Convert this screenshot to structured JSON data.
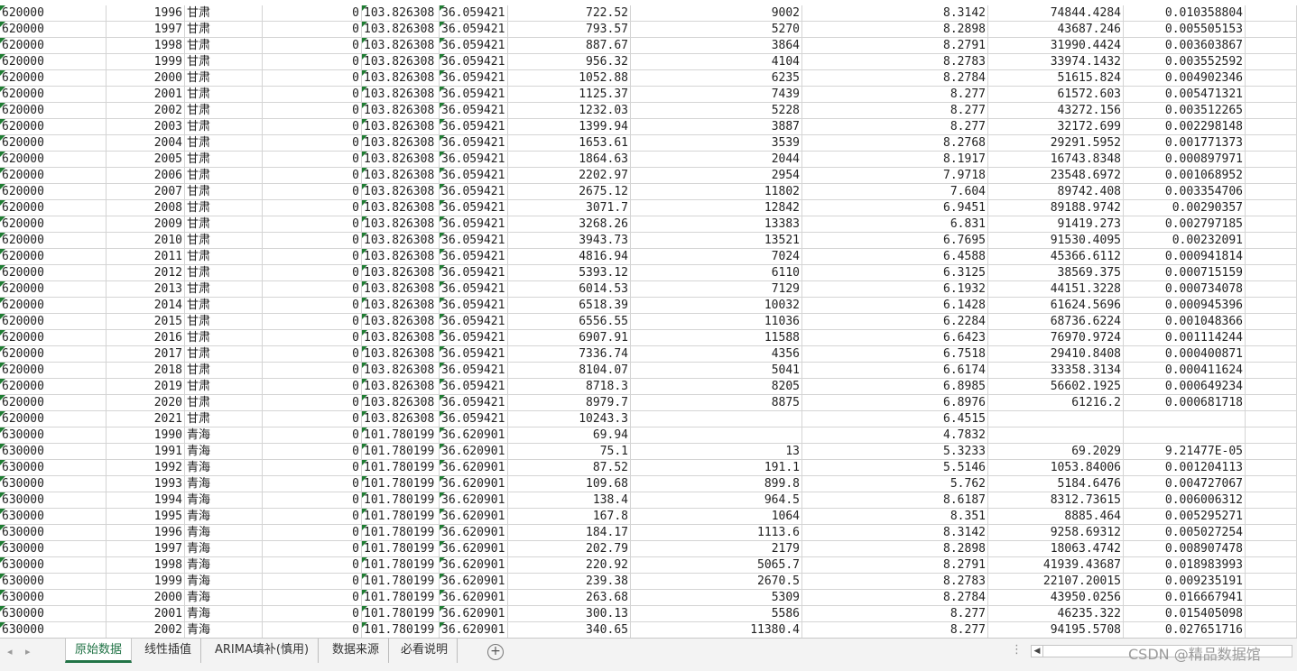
{
  "sheet_tabs": [
    {
      "label": "原始数据",
      "active": true
    },
    {
      "label": "线性插值",
      "active": false
    },
    {
      "label": "ARIMA填补(慎用)",
      "active": false
    },
    {
      "label": "数据来源",
      "active": false
    },
    {
      "label": "必看说明",
      "active": false
    }
  ],
  "add_sheet_symbol": "+",
  "watermark": "CSDN @精品数据馆",
  "colors": {
    "active_tab": "#217346",
    "grid_line": "#d4d4d4",
    "error_triangle": "#1e7d32"
  },
  "rows": [
    [
      "620000",
      "1996",
      "甘肃",
      "0",
      "103.826308",
      "36.059421",
      "722.52",
      "9002",
      "8.3142",
      "74844.4284",
      "0.010358804"
    ],
    [
      "620000",
      "1997",
      "甘肃",
      "0",
      "103.826308",
      "36.059421",
      "793.57",
      "5270",
      "8.2898",
      "43687.246",
      "0.005505153"
    ],
    [
      "620000",
      "1998",
      "甘肃",
      "0",
      "103.826308",
      "36.059421",
      "887.67",
      "3864",
      "8.2791",
      "31990.4424",
      "0.003603867"
    ],
    [
      "620000",
      "1999",
      "甘肃",
      "0",
      "103.826308",
      "36.059421",
      "956.32",
      "4104",
      "8.2783",
      "33974.1432",
      "0.003552592"
    ],
    [
      "620000",
      "2000",
      "甘肃",
      "0",
      "103.826308",
      "36.059421",
      "1052.88",
      "6235",
      "8.2784",
      "51615.824",
      "0.004902346"
    ],
    [
      "620000",
      "2001",
      "甘肃",
      "0",
      "103.826308",
      "36.059421",
      "1125.37",
      "7439",
      "8.277",
      "61572.603",
      "0.005471321"
    ],
    [
      "620000",
      "2002",
      "甘肃",
      "0",
      "103.826308",
      "36.059421",
      "1232.03",
      "5228",
      "8.277",
      "43272.156",
      "0.003512265"
    ],
    [
      "620000",
      "2003",
      "甘肃",
      "0",
      "103.826308",
      "36.059421",
      "1399.94",
      "3887",
      "8.277",
      "32172.699",
      "0.002298148"
    ],
    [
      "620000",
      "2004",
      "甘肃",
      "0",
      "103.826308",
      "36.059421",
      "1653.61",
      "3539",
      "8.2768",
      "29291.5952",
      "0.001771373"
    ],
    [
      "620000",
      "2005",
      "甘肃",
      "0",
      "103.826308",
      "36.059421",
      "1864.63",
      "2044",
      "8.1917",
      "16743.8348",
      "0.000897971"
    ],
    [
      "620000",
      "2006",
      "甘肃",
      "0",
      "103.826308",
      "36.059421",
      "2202.97",
      "2954",
      "7.9718",
      "23548.6972",
      "0.001068952"
    ],
    [
      "620000",
      "2007",
      "甘肃",
      "0",
      "103.826308",
      "36.059421",
      "2675.12",
      "11802",
      "7.604",
      "89742.408",
      "0.003354706"
    ],
    [
      "620000",
      "2008",
      "甘肃",
      "0",
      "103.826308",
      "36.059421",
      "3071.7",
      "12842",
      "6.9451",
      "89188.9742",
      "0.00290357"
    ],
    [
      "620000",
      "2009",
      "甘肃",
      "0",
      "103.826308",
      "36.059421",
      "3268.26",
      "13383",
      "6.831",
      "91419.273",
      "0.002797185"
    ],
    [
      "620000",
      "2010",
      "甘肃",
      "0",
      "103.826308",
      "36.059421",
      "3943.73",
      "13521",
      "6.7695",
      "91530.4095",
      "0.00232091"
    ],
    [
      "620000",
      "2011",
      "甘肃",
      "0",
      "103.826308",
      "36.059421",
      "4816.94",
      "7024",
      "6.4588",
      "45366.6112",
      "0.000941814"
    ],
    [
      "620000",
      "2012",
      "甘肃",
      "0",
      "103.826308",
      "36.059421",
      "5393.12",
      "6110",
      "6.3125",
      "38569.375",
      "0.000715159"
    ],
    [
      "620000",
      "2013",
      "甘肃",
      "0",
      "103.826308",
      "36.059421",
      "6014.53",
      "7129",
      "6.1932",
      "44151.3228",
      "0.000734078"
    ],
    [
      "620000",
      "2014",
      "甘肃",
      "0",
      "103.826308",
      "36.059421",
      "6518.39",
      "10032",
      "6.1428",
      "61624.5696",
      "0.000945396"
    ],
    [
      "620000",
      "2015",
      "甘肃",
      "0",
      "103.826308",
      "36.059421",
      "6556.55",
      "11036",
      "6.2284",
      "68736.6224",
      "0.001048366"
    ],
    [
      "620000",
      "2016",
      "甘肃",
      "0",
      "103.826308",
      "36.059421",
      "6907.91",
      "11588",
      "6.6423",
      "76970.9724",
      "0.001114244"
    ],
    [
      "620000",
      "2017",
      "甘肃",
      "0",
      "103.826308",
      "36.059421",
      "7336.74",
      "4356",
      "6.7518",
      "29410.8408",
      "0.000400871"
    ],
    [
      "620000",
      "2018",
      "甘肃",
      "0",
      "103.826308",
      "36.059421",
      "8104.07",
      "5041",
      "6.6174",
      "33358.3134",
      "0.000411624"
    ],
    [
      "620000",
      "2019",
      "甘肃",
      "0",
      "103.826308",
      "36.059421",
      "8718.3",
      "8205",
      "6.8985",
      "56602.1925",
      "0.000649234"
    ],
    [
      "620000",
      "2020",
      "甘肃",
      "0",
      "103.826308",
      "36.059421",
      "8979.7",
      "8875",
      "6.8976",
      "61216.2",
      "0.000681718"
    ],
    [
      "620000",
      "2021",
      "甘肃",
      "0",
      "103.826308",
      "36.059421",
      "10243.3",
      "",
      "6.4515",
      "",
      ""
    ],
    [
      "630000",
      "1990",
      "青海",
      "0",
      "101.780199",
      "36.620901",
      "69.94",
      "",
      "4.7832",
      "",
      ""
    ],
    [
      "630000",
      "1991",
      "青海",
      "0",
      "101.780199",
      "36.620901",
      "75.1",
      "13",
      "5.3233",
      "69.2029",
      "9.21477E-05"
    ],
    [
      "630000",
      "1992",
      "青海",
      "0",
      "101.780199",
      "36.620901",
      "87.52",
      "191.1",
      "5.5146",
      "1053.84006",
      "0.001204113"
    ],
    [
      "630000",
      "1993",
      "青海",
      "0",
      "101.780199",
      "36.620901",
      "109.68",
      "899.8",
      "5.762",
      "5184.6476",
      "0.004727067"
    ],
    [
      "630000",
      "1994",
      "青海",
      "0",
      "101.780199",
      "36.620901",
      "138.4",
      "964.5",
      "8.6187",
      "8312.73615",
      "0.006006312"
    ],
    [
      "630000",
      "1995",
      "青海",
      "0",
      "101.780199",
      "36.620901",
      "167.8",
      "1064",
      "8.351",
      "8885.464",
      "0.005295271"
    ],
    [
      "630000",
      "1996",
      "青海",
      "0",
      "101.780199",
      "36.620901",
      "184.17",
      "1113.6",
      "8.3142",
      "9258.69312",
      "0.005027254"
    ],
    [
      "630000",
      "1997",
      "青海",
      "0",
      "101.780199",
      "36.620901",
      "202.79",
      "2179",
      "8.2898",
      "18063.4742",
      "0.008907478"
    ],
    [
      "630000",
      "1998",
      "青海",
      "0",
      "101.780199",
      "36.620901",
      "220.92",
      "5065.7",
      "8.2791",
      "41939.43687",
      "0.018983993"
    ],
    [
      "630000",
      "1999",
      "青海",
      "0",
      "101.780199",
      "36.620901",
      "239.38",
      "2670.5",
      "8.2783",
      "22107.20015",
      "0.009235191"
    ],
    [
      "630000",
      "2000",
      "青海",
      "0",
      "101.780199",
      "36.620901",
      "263.68",
      "5309",
      "8.2784",
      "43950.0256",
      "0.016667941"
    ],
    [
      "630000",
      "2001",
      "青海",
      "0",
      "101.780199",
      "36.620901",
      "300.13",
      "5586",
      "8.277",
      "46235.322",
      "0.015405098"
    ],
    [
      "630000",
      "2002",
      "青海",
      "0",
      "101.780199",
      "36.620901",
      "340.65",
      "11380.4",
      "8.277",
      "94195.5708",
      "0.027651716"
    ]
  ]
}
